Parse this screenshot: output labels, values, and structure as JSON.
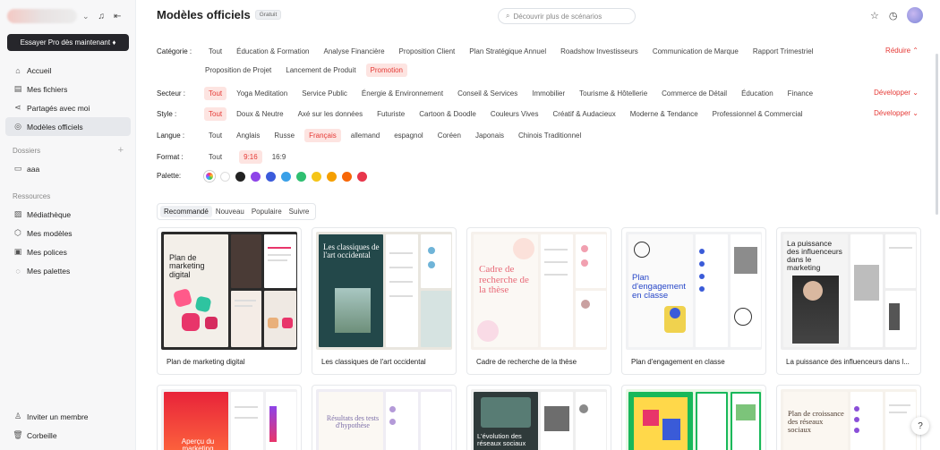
{
  "sidebar": {
    "pro_button": "Essayer Pro dès maintenant ♦",
    "nav": [
      {
        "label": "Accueil",
        "icon": "home-icon",
        "glyph": "⌂"
      },
      {
        "label": "Mes fichiers",
        "icon": "file-icon",
        "glyph": "▤"
      },
      {
        "label": "Partagés avec moi",
        "icon": "share-icon",
        "glyph": "⋖"
      },
      {
        "label": "Modèles officiels",
        "icon": "templates-icon",
        "glyph": "◎"
      }
    ],
    "folders_title": "Dossiers",
    "folders": [
      {
        "label": "aaa",
        "icon": "folder-icon",
        "glyph": "▭"
      }
    ],
    "resources_title": "Ressources",
    "resources": [
      {
        "label": "Médiathèque",
        "icon": "media-library-icon",
        "glyph": "▨"
      },
      {
        "label": "Mes modèles",
        "icon": "my-templates-icon",
        "glyph": "⬡"
      },
      {
        "label": "Mes polices",
        "icon": "fonts-icon",
        "glyph": "▣"
      },
      {
        "label": "Mes palettes",
        "icon": "palette-icon",
        "glyph": "◌"
      }
    ],
    "bottom": [
      {
        "label": "Inviter un membre",
        "icon": "invite-icon",
        "glyph": "♙"
      },
      {
        "label": "Corbeille",
        "icon": "trash-icon",
        "glyph": "🗑"
      }
    ]
  },
  "header": {
    "title": "Modèles officiels",
    "badge": "Gratuit",
    "search_placeholder": "Découvrir plus de scénarios"
  },
  "filters": {
    "category": {
      "label": "Catégorie :",
      "row1": [
        "Tout",
        "Éducation & Formation",
        "Analyse Financière",
        "Proposition Client",
        "Plan Stratégique Annuel",
        "Roadshow Investisseurs",
        "Communication de Marque",
        "Rapport Trimestriel"
      ],
      "row2": [
        "Proposition de Projet",
        "Lancement de Produit",
        "Promotion"
      ],
      "selected": "Promotion",
      "action": "Réduire ⌃"
    },
    "sector": {
      "label": "Secteur :",
      "items": [
        "Tout",
        "Yoga Meditation",
        "Service Public",
        "Énergie & Environnement",
        "Conseil & Services",
        "Immobilier",
        "Tourisme & Hôtellerie",
        "Commerce de Détail",
        "Éducation",
        "Finance"
      ],
      "selected": "Tout",
      "action": "Développer ⌄"
    },
    "style": {
      "label": "Style :",
      "items": [
        "Tout",
        "Doux & Neutre",
        "Axé sur les données",
        "Futuriste",
        "Cartoon & Doodle",
        "Couleurs Vives",
        "Créatif & Audacieux",
        "Moderne & Tendance",
        "Professionnel & Commercial"
      ],
      "selected": "Tout",
      "action": "Développer ⌄"
    },
    "language": {
      "label": "Langue :",
      "items": [
        "Tout",
        "Anglais",
        "Russe",
        "Français",
        "allemand",
        "espagnol",
        "Coréen",
        "Japonais",
        "Chinois Traditionnel"
      ],
      "selected": "Français"
    },
    "format": {
      "label": "Format :",
      "items": [
        "Tout",
        "9:16",
        "16:9"
      ],
      "selected": "9:16"
    },
    "palette": {
      "label": "Palette:",
      "colors": [
        "#222222",
        "#8e44e8",
        "#3b5bdb",
        "#3aa0e8",
        "#2fbf71",
        "#f5c518",
        "#f59f00",
        "#f76707",
        "#e8364b"
      ]
    }
  },
  "sort_tabs": {
    "items": [
      "Recommandé",
      "Nouveau",
      "Populaire",
      "Suivre"
    ],
    "selected": "Recommandé"
  },
  "cards_row1": [
    {
      "name": "Plan de marketing digital",
      "cover": "Plan de marketing digital"
    },
    {
      "name": "Les classiques de l'art occidental",
      "cover": "Les classiques de l'art occidental"
    },
    {
      "name": "Cadre de recherche de la thèse",
      "cover": "Cadre de recherche de la thèse"
    },
    {
      "name": "Plan d'engagement en classe",
      "cover": "Plan d'engagement en classe"
    },
    {
      "name": "La puissance des influenceurs dans l...",
      "cover": "La puissance des influenceurs dans le marketing"
    }
  ],
  "cards_row2": [
    {
      "cover": "Aperçu du marketing"
    },
    {
      "cover": "Résultats des tests d'hypothèse"
    },
    {
      "cover": "L'évolution des réseaux sociaux"
    },
    {
      "cover": ""
    },
    {
      "cover": "Plan de croissance des réseaux sociaux"
    }
  ],
  "help_label": "?"
}
